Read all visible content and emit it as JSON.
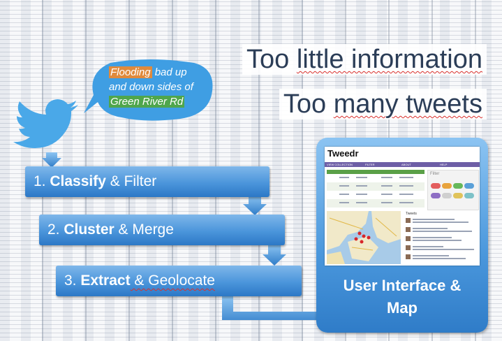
{
  "headlines": {
    "line1_plain": "Too ",
    "line1_underlined": "little information",
    "line2_plain": "Too ",
    "line2_underlined": "many tweets"
  },
  "tweet_bubble": {
    "flooding": "Flooding",
    "text1": " bad up",
    "text2": "and down sides of",
    "road": "Green River Rd"
  },
  "steps": [
    {
      "number": "1. ",
      "bold": "Classify",
      "rest": " & Filter"
    },
    {
      "number": "2. ",
      "bold": "Cluster",
      "rest": " & Merge"
    },
    {
      "number": "3. ",
      "bold": "Extract",
      "rest": " & Geolocate"
    }
  ],
  "ui_panel": {
    "title_line1": "User Interface &",
    "title_line2": "Map",
    "app_name": "Tweedr",
    "nav": [
      "VIEW COLLECTION",
      "FILTER",
      "ABOUT",
      "HELP"
    ],
    "filter_label": "Filter",
    "tweets_label": "Tweets"
  },
  "colors": {
    "step_blue": "#4b95db",
    "headline": "#2b3d57",
    "twitter_blue": "#4aa8e8",
    "orange_highlight": "#e08a3c",
    "green_highlight": "#4fa64c",
    "nav_purple": "#6d5ea6"
  }
}
